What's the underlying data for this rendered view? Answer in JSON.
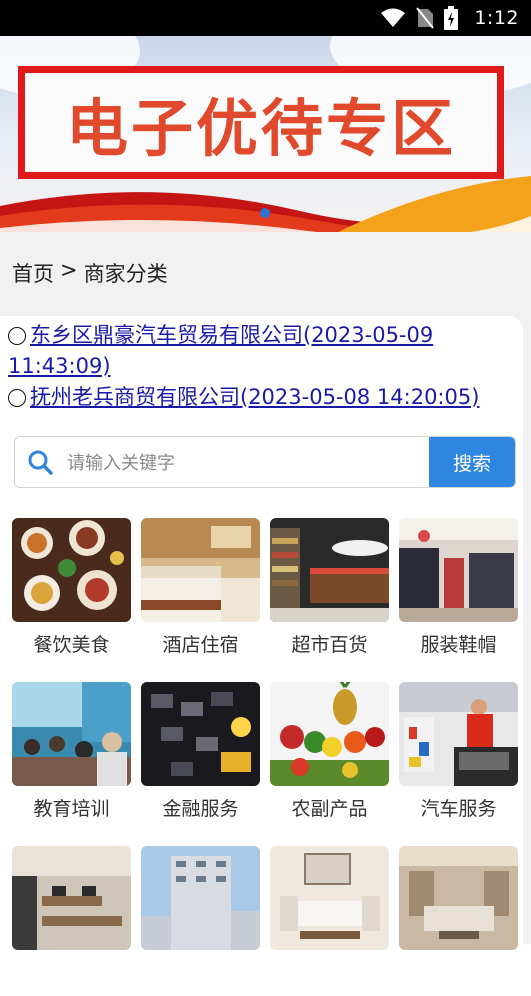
{
  "status_bar": {
    "time": "1:12"
  },
  "banner": {
    "title": "电子优待专区"
  },
  "breadcrumb": {
    "home": "首页",
    "separator": ">",
    "current": "商家分类"
  },
  "news": [
    {
      "title": "东乡区鼎豪汽车贸易有限公司(2023-05-09 11:43:09)"
    },
    {
      "title": "抚州老兵商贸有限公司(2023-05-08 14:20:05)"
    }
  ],
  "search": {
    "placeholder": "请输入关键字",
    "button_label": "搜索"
  },
  "categories": [
    {
      "label": "餐饮美食"
    },
    {
      "label": "酒店住宿"
    },
    {
      "label": "超市百货"
    },
    {
      "label": "服装鞋帽"
    },
    {
      "label": "教育培训"
    },
    {
      "label": "金融服务"
    },
    {
      "label": "农副产品"
    },
    {
      "label": "汽车服务"
    },
    {
      "label": ""
    },
    {
      "label": ""
    },
    {
      "label": ""
    },
    {
      "label": ""
    }
  ],
  "colors": {
    "accent": "#2f86e0",
    "banner_red": "#e01a1a",
    "link": "#1a1aa8"
  }
}
